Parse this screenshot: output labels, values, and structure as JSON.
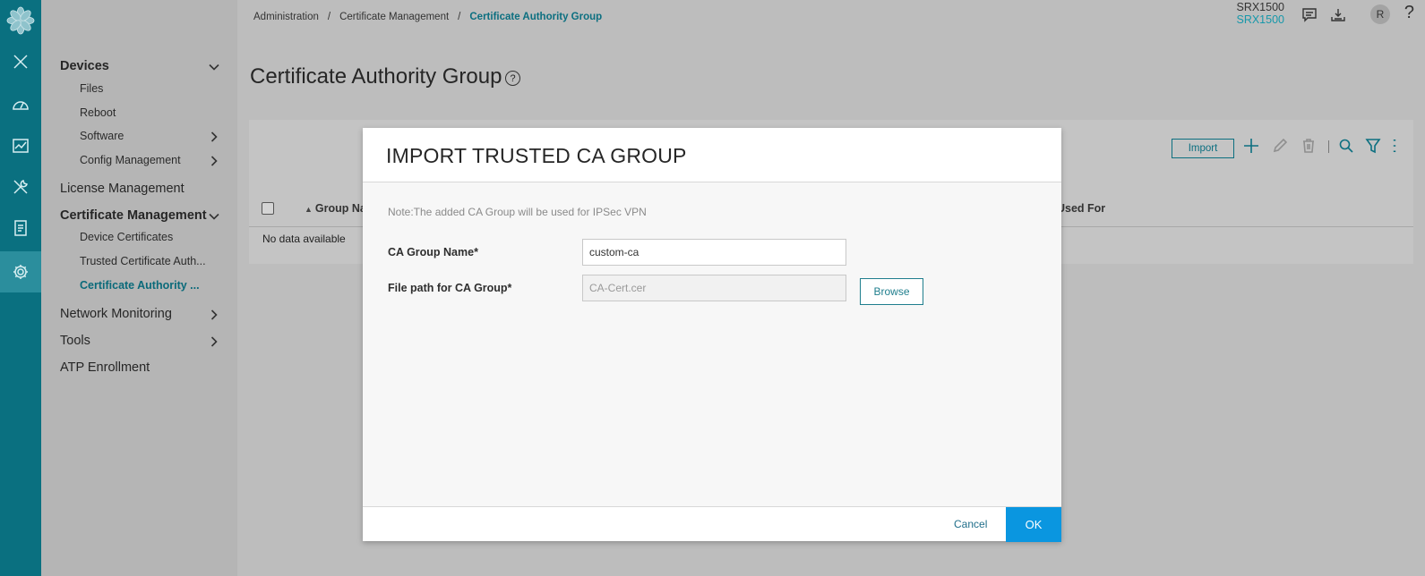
{
  "header": {
    "device_name": "SRX1500",
    "device_model": "SRX1500",
    "avatar_initial": "R",
    "help_symbol": "?"
  },
  "breadcrumb": {
    "items": [
      "Administration",
      "Certificate Management",
      "Certificate Authority Group"
    ],
    "separator": "/"
  },
  "page": {
    "title": "Certificate Authority Group",
    "help_icon": "?"
  },
  "rail": {
    "icons": [
      "logo-flower-icon",
      "close-icon",
      "dashboard-gauge-icon",
      "monitor-chart-icon",
      "tools-wrench-icon",
      "reports-document-icon",
      "settings-gear-icon"
    ],
    "active": "settings-gear-icon"
  },
  "sidebar": {
    "items": [
      {
        "label": "Devices",
        "level": 1,
        "bold": true,
        "chevron": "down"
      },
      {
        "label": "Files",
        "level": 2
      },
      {
        "label": "Reboot",
        "level": 2
      },
      {
        "label": "Software",
        "level": 2,
        "chevron": "right"
      },
      {
        "label": "Config Management",
        "level": 2,
        "chevron": "right"
      },
      {
        "label": "License Management",
        "level": 1
      },
      {
        "label": "Certificate Management",
        "level": 1,
        "bold": true,
        "chevron": "down"
      },
      {
        "label": "Device Certificates",
        "level": 2
      },
      {
        "label": "Trusted Certificate Auth...",
        "level": 2
      },
      {
        "label": "Certificate Authority ...",
        "level": 2,
        "active": true
      },
      {
        "label": "Network Monitoring",
        "level": 1,
        "chevron": "right"
      },
      {
        "label": "Tools",
        "level": 1,
        "chevron": "right"
      },
      {
        "label": "ATP Enrollment",
        "level": 1
      }
    ]
  },
  "grid": {
    "import_label": "Import",
    "columns": [
      "Group Na",
      "Used For"
    ],
    "empty_message": "No data available",
    "toolbar_icons": [
      "add-plus-icon",
      "edit-pencil-icon",
      "delete-trash-icon",
      "search-icon",
      "filter-icon",
      "more-vertical-icon"
    ]
  },
  "modal": {
    "title": "IMPORT TRUSTED CA GROUP",
    "note": "Note:The added CA Group will be used for IPSec VPN",
    "fields": {
      "ca_group_name": {
        "label": "CA Group Name*",
        "value": "custom-ca"
      },
      "file_path": {
        "label": "File path for CA Group*",
        "value": "CA-Cert.cer"
      }
    },
    "browse_label": "Browse",
    "cancel_label": "Cancel",
    "ok_label": "OK"
  },
  "colors": {
    "rail": "#0a7080",
    "accent": "#0c6f80",
    "ok_button": "#0a96e0",
    "device_model": "#1798aa"
  }
}
